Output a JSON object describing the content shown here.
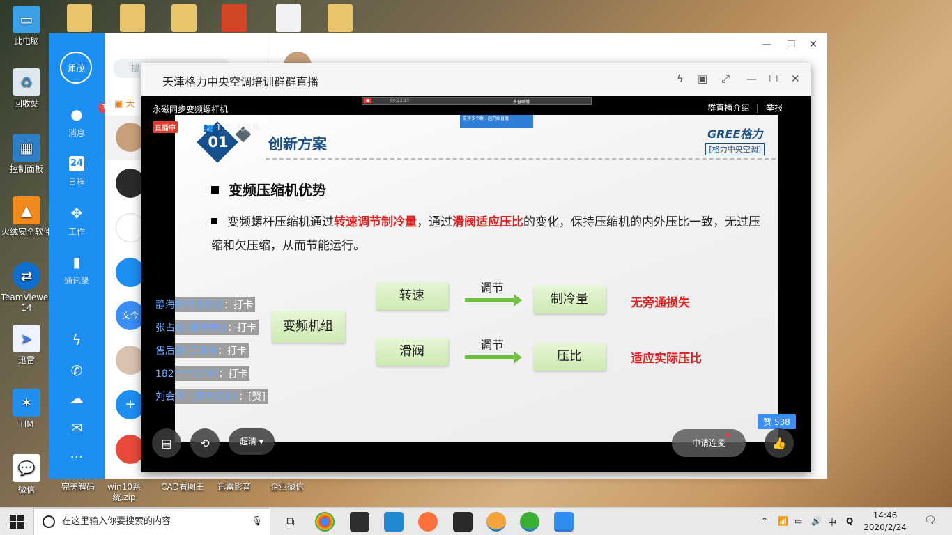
{
  "desktop": {
    "icons": [
      {
        "label": "此电脑"
      },
      {
        "label": "回收站"
      },
      {
        "label": "控制面板"
      },
      {
        "label": "火绒安全软件"
      },
      {
        "label": "TeamViewer 14"
      },
      {
        "label": "迅雷"
      },
      {
        "label": "TIM"
      },
      {
        "label": "微信"
      }
    ],
    "bottom_labels": [
      "完美解码",
      "win10系统.zip",
      "CAD看图王",
      "迅雷影音",
      "企业微信"
    ]
  },
  "tim": {
    "avatar_text": "师茂",
    "nav": {
      "messages": {
        "label": "消息",
        "badge": "31"
      },
      "calendar": {
        "label": "日程",
        "day": "24"
      },
      "work": {
        "label": "工作"
      },
      "contacts": {
        "label": "通讯录"
      }
    },
    "search_placeholder": "搜",
    "list": {
      "pinned": "天",
      "doc_avatar": "文今"
    }
  },
  "live": {
    "window_title": "天津格力中央空调培训群群直播",
    "stream_name": "永磁同步变频螺杆机",
    "live_badge": "直播中",
    "viewers": "135 人观看",
    "intro_link": "群直播介绍",
    "report_link": "举报",
    "record_bar": {
      "timer": "00:23:13",
      "mode": "多窗联播"
    },
    "record_popup": "支持多个群一起开始直播",
    "slide": {
      "number": "01",
      "section_title": "创新方案",
      "logo_text": "GREE格力",
      "logo_sub": "[格力中央空调]",
      "heading": "变频压缩机优势",
      "para_parts": [
        "变频螺杆压缩机通过",
        "转速调节制冷量",
        "，通过",
        "滑阀适应压比",
        "的变化，保持压缩机的内外压比一致，无过压缩和欠压缩，从而节能运行。"
      ],
      "diagram": {
        "unit": "变频机组",
        "row1": {
          "input": "转速",
          "action": "调节",
          "output": "制冷量",
          "result": "无旁通损失"
        },
        "row2": {
          "input": "滑阀",
          "action": "调节",
          "output": "压比",
          "result": "适应实际压比"
        }
      }
    },
    "chat": [
      {
        "name": "静海物流张振振",
        "msg": "：打卡"
      },
      {
        "name": "张占友-融海伟业",
        "msg": "：打卡"
      },
      {
        "name": "售后部-王冰冰",
        "msg": "：打卡"
      },
      {
        "name": "182****2797",
        "msg": "：打卡"
      },
      {
        "name": "刘会萍（源丰实业）",
        "msg": "：[赞]"
      }
    ],
    "quality": "超清",
    "link_mic": "申请连麦",
    "likes": "赞 538"
  },
  "taskbar": {
    "search_placeholder": "在这里输入你要搜索的内容",
    "ime": "中",
    "time": "14:46",
    "date": "2020/2/24"
  }
}
